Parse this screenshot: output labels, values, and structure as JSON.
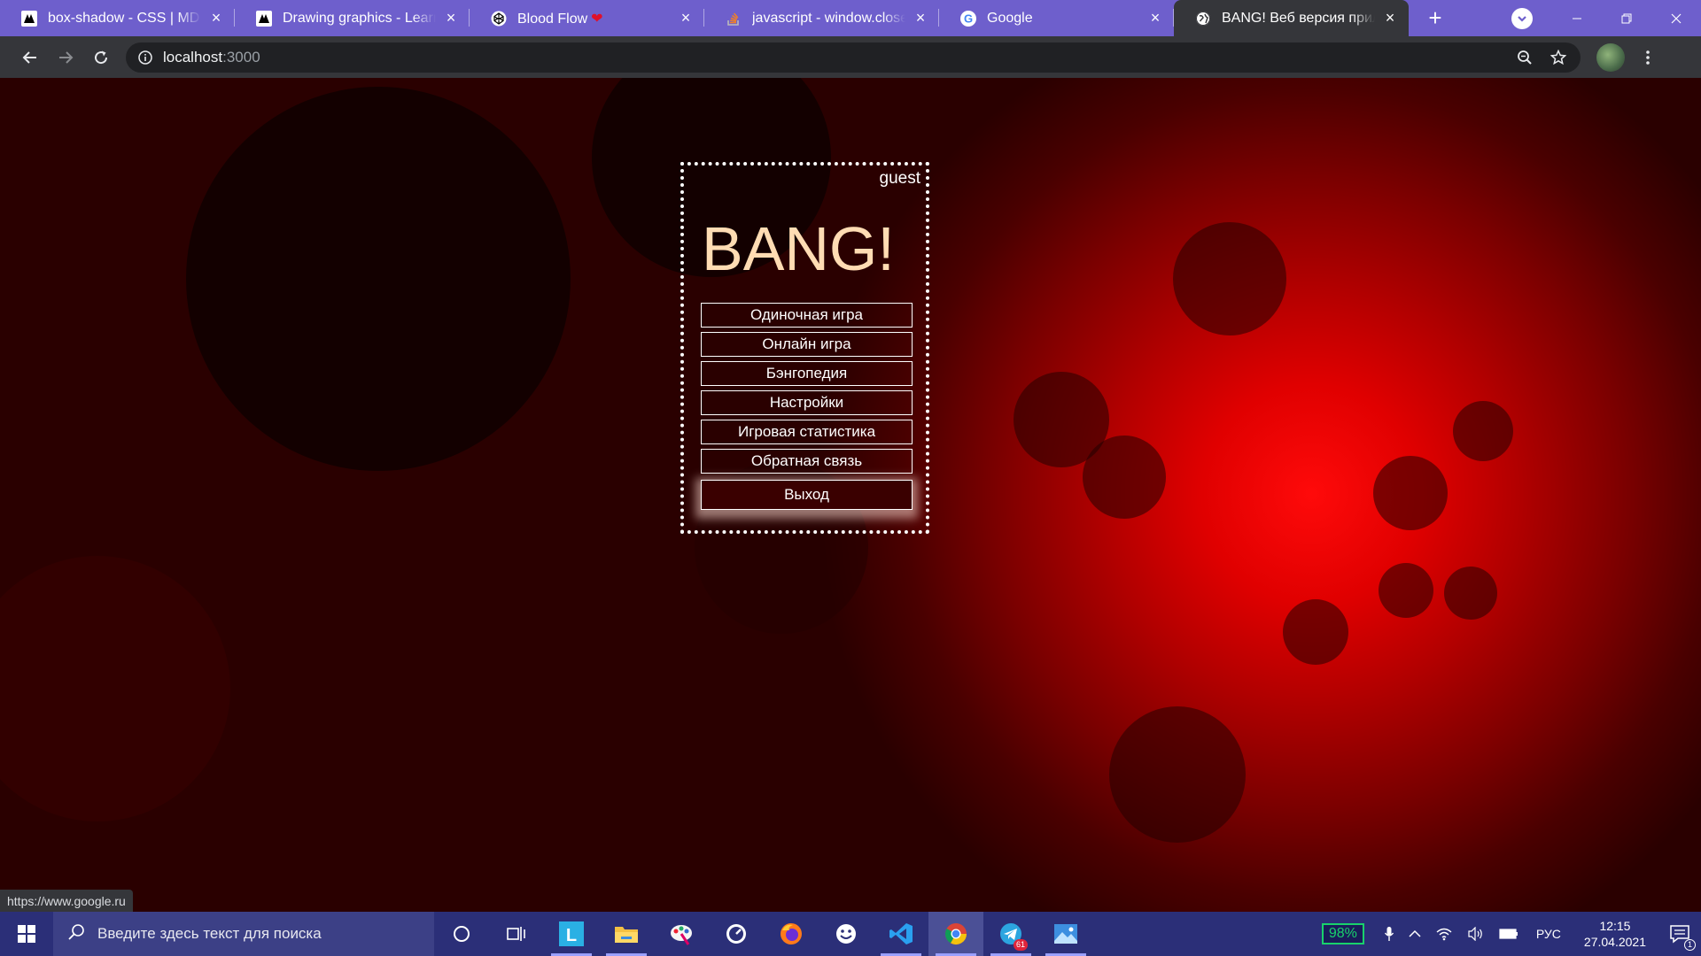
{
  "browser": {
    "tabs": [
      {
        "title": "box-shadow - CSS | MDN",
        "favicon": "mdn-icon",
        "active": false
      },
      {
        "title": "Drawing graphics - Learn web development | MDN",
        "favicon": "mdn-icon",
        "active": false
      },
      {
        "title": "Blood Flow",
        "favicon": "codepen-icon",
        "heart": "❤",
        "active": false
      },
      {
        "title": "javascript - window.close and self.close",
        "favicon": "stackoverflow-icon",
        "active": false
      },
      {
        "title": "Google",
        "favicon": "google-icon",
        "active": false
      },
      {
        "title": "BANG! Веб версия приложения",
        "favicon": "globe-icon",
        "active": true
      }
    ],
    "new_tab_label": "+",
    "address": {
      "host": "localhost",
      "port": ":3000"
    }
  },
  "page": {
    "user": "guest",
    "title": "BANG!",
    "menu": [
      "Одиночная игра",
      "Онлайн игра",
      "Бэнгопедия",
      "Настройки",
      "Игровая статистика",
      "Обратная связь",
      "Выход"
    ],
    "colors": {
      "title": "#ffdcb3",
      "background": "#b10000",
      "border": "#ffffff"
    }
  },
  "status_url": "https://www.google.ru",
  "taskbar": {
    "search_placeholder": "Введите здесь текст для поиска",
    "apps": [
      "cortana-icon",
      "task-view-icon",
      "l-app-icon",
      "file-explorer-icon",
      "paint-icon",
      "timer-icon",
      "firefox-icon",
      "smiley-app-icon",
      "vscode-icon",
      "chrome-icon",
      "telegram-icon",
      "photos-icon"
    ],
    "telegram_badge": "61",
    "battery": "98%",
    "language": "РУС",
    "time": "12:15",
    "date": "27.04.2021",
    "notification_badge": "1"
  }
}
